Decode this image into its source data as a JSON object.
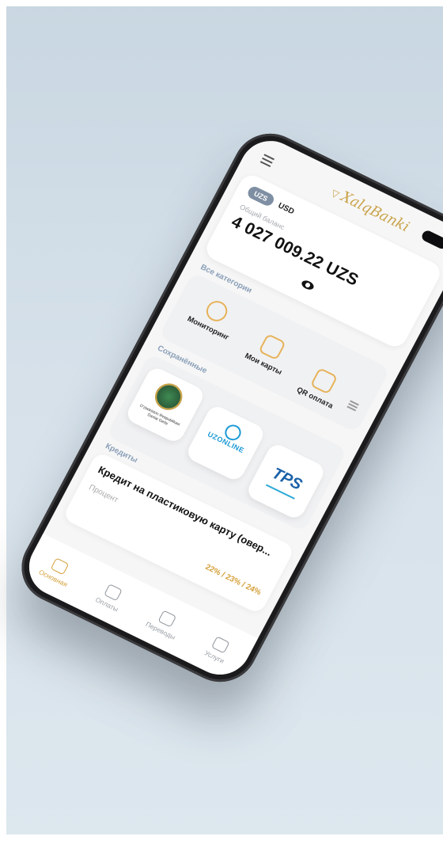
{
  "app": {
    "logo_text": "XalqBanki",
    "logo_mark": "▽"
  },
  "balance": {
    "currency_active": "UZS",
    "currency_other": "USD",
    "label": "Общий баланс",
    "value": "4 027 009.22 UZS"
  },
  "categories": {
    "title": "Все категории",
    "items": [
      {
        "label": "Мониторинг"
      },
      {
        "label": "Мои карты"
      },
      {
        "label": "QR оплата"
      }
    ]
  },
  "saved": {
    "title": "Сохранённые",
    "tiles": [
      {
        "caption": "Oʻzbekiston Respublikasi Davlat Gerbi"
      },
      {
        "label": "UZONLINE"
      },
      {
        "label": "TPS"
      }
    ]
  },
  "credits": {
    "title": "Кредиты",
    "card_title": "Кредит на пластиковую карту (овер...",
    "rate_label": "Процент",
    "rate_value": "22% / 23% / 24%"
  },
  "nav": {
    "items": [
      {
        "label": "Основная",
        "active": true
      },
      {
        "label": "Оплаты",
        "active": false
      },
      {
        "label": "Переводы",
        "active": false
      },
      {
        "label": "Услуги",
        "active": false
      }
    ]
  },
  "colors": {
    "accent": "#d4a03a",
    "section": "#8a9fb8",
    "brand_blue": "#1c9ad6"
  }
}
